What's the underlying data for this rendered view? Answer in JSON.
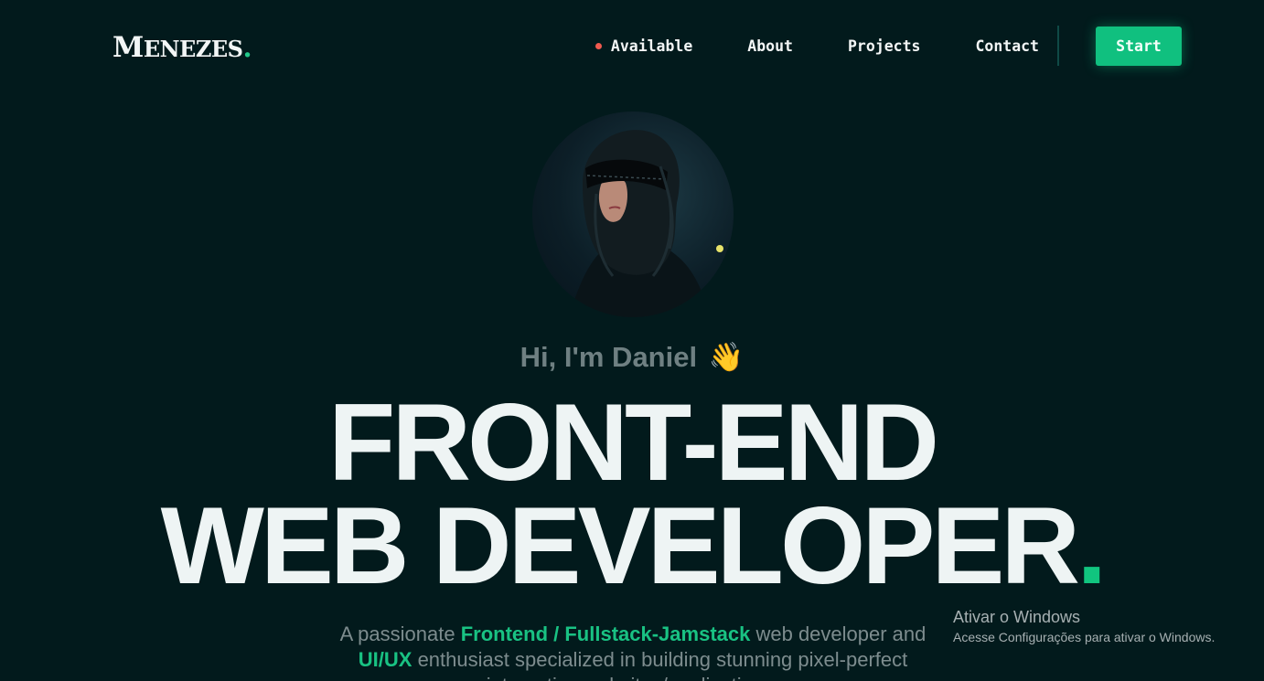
{
  "header": {
    "logo_first": "M",
    "logo_rest": "ENEZES",
    "logo_dot": ".",
    "nav": [
      {
        "label": "Available"
      },
      {
        "label": "About"
      },
      {
        "label": "Projects"
      },
      {
        "label": "Contact"
      }
    ],
    "cta_label": "Start"
  },
  "hero": {
    "greeting": "Hi, I'm Daniel",
    "wave_emoji": "👋",
    "headline_line1": "FRONT-END",
    "headline_line2": "WEB DEVELOPER",
    "headline_dot": ".",
    "bio": {
      "part1": "A passionate ",
      "hl1": "Frontend / Fullstack-Jamstack",
      "part2": " web developer and ",
      "hl2": "UI/UX",
      "part3": " enthusiast specialized in building stunning pixel-perfect interactive websites/applications."
    }
  },
  "watermark": {
    "title": "Ativar o Windows",
    "subtitle": "Acesse Configurações para ativar o Windows."
  },
  "colors": {
    "background": "#021a1c",
    "accent": "#10c07f",
    "status_dot": "#f05a4f"
  }
}
